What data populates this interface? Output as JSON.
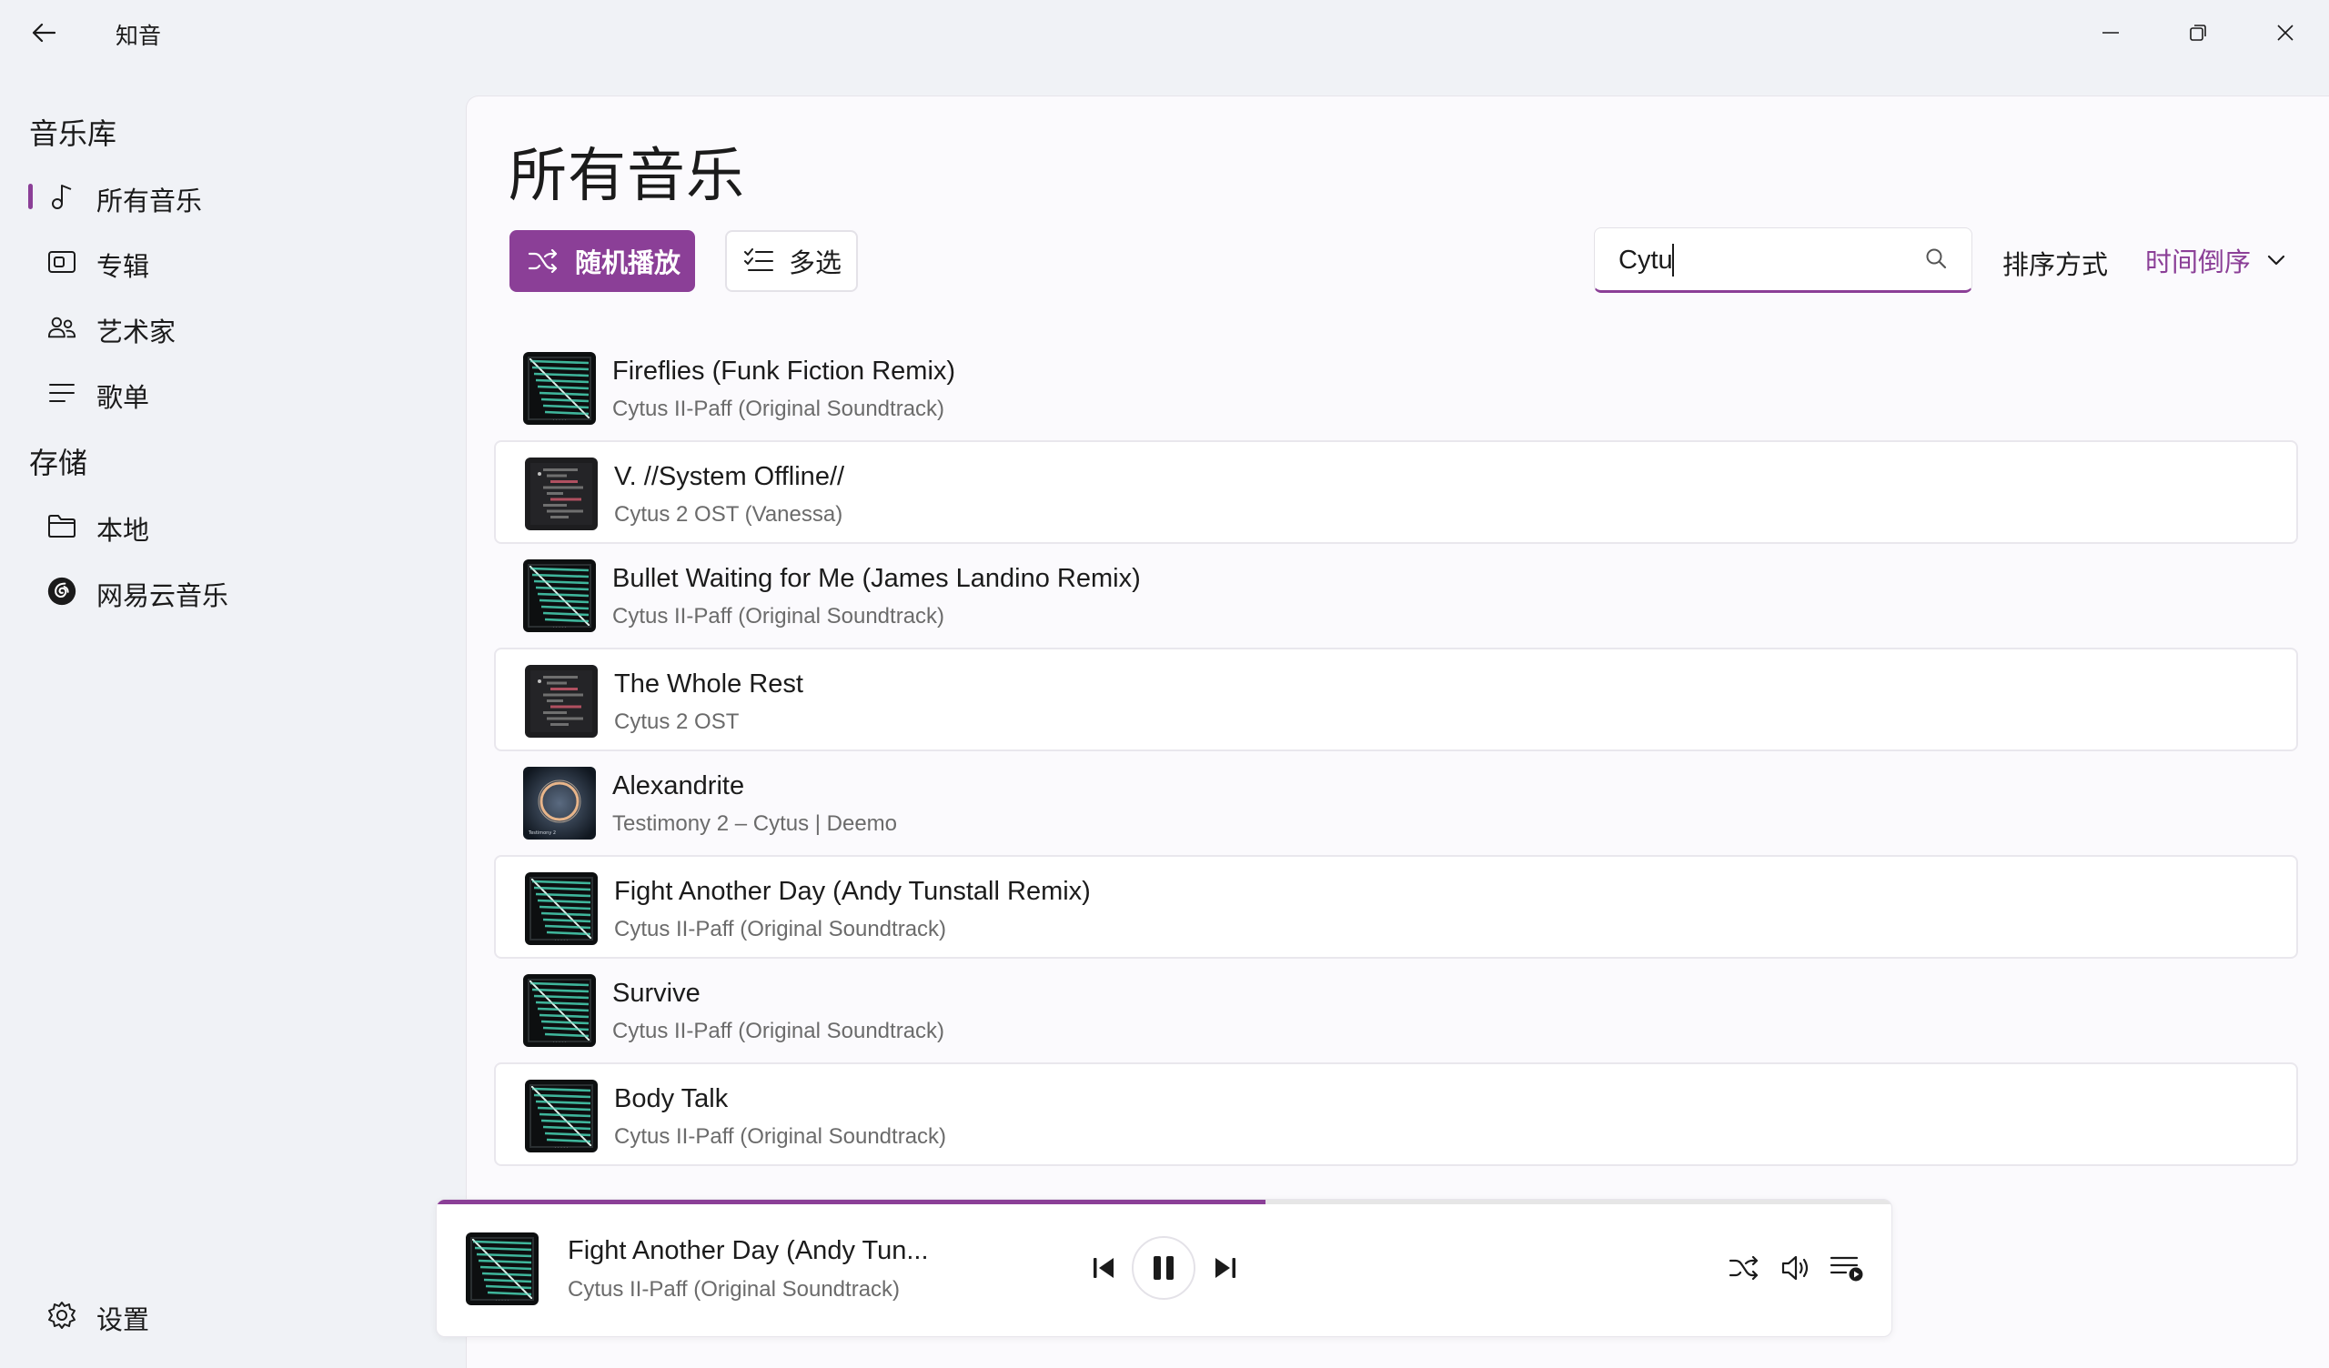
{
  "window": {
    "title": "知音"
  },
  "sidebar": {
    "library_header": "音乐库",
    "library_items": [
      {
        "label": "所有音乐",
        "icon": "music-note-icon",
        "active": true
      },
      {
        "label": "专辑",
        "icon": "album-icon",
        "active": false
      },
      {
        "label": "艺术家",
        "icon": "people-icon",
        "active": false
      },
      {
        "label": "歌单",
        "icon": "list-icon",
        "active": false
      }
    ],
    "storage_header": "存储",
    "storage_items": [
      {
        "label": "本地",
        "icon": "folder-icon"
      },
      {
        "label": "网易云音乐",
        "icon": "netease-cloud-icon"
      }
    ],
    "settings_label": "设置"
  },
  "main": {
    "title": "所有音乐",
    "shuffle_label": "随机播放",
    "multiselect_label": "多选",
    "search_value": "Cytu",
    "sort_label": "排序方式",
    "sort_value": "时间倒序"
  },
  "songs": [
    {
      "title": "Fireflies (Funk Fiction Remix)",
      "subtitle": "Cytus II-Paff (Original Soundtrack)",
      "cover": "paff"
    },
    {
      "title": "V. //System Offline//",
      "subtitle": "Cytus 2 OST (Vanessa)",
      "cover": "dark"
    },
    {
      "title": "Bullet Waiting for Me (James Landino Remix)",
      "subtitle": "Cytus II-Paff (Original Soundtrack)",
      "cover": "paff"
    },
    {
      "title": "The Whole Rest",
      "subtitle": "Cytus 2 OST",
      "cover": "dark"
    },
    {
      "title": "Alexandrite",
      "subtitle": "Testimony 2 – Cytus | Deemo",
      "cover": "ring"
    },
    {
      "title": "Fight Another Day (Andy Tunstall Remix)",
      "subtitle": "Cytus II-Paff (Original Soundtrack)",
      "cover": "paff"
    },
    {
      "title": "Survive",
      "subtitle": "Cytus II-Paff (Original Soundtrack)",
      "cover": "paff"
    },
    {
      "title": "Body Talk",
      "subtitle": "Cytus II-Paff (Original Soundtrack)",
      "cover": "paff"
    }
  ],
  "player": {
    "title": "Fight Another Day (Andy Tun...",
    "subtitle": "Cytus II-Paff (Original Soundtrack)",
    "progress": 0.57,
    "state": "playing"
  },
  "colors": {
    "accent": "#8b3f97",
    "background": "#f0f2f6",
    "panel": "#fbfafd"
  }
}
